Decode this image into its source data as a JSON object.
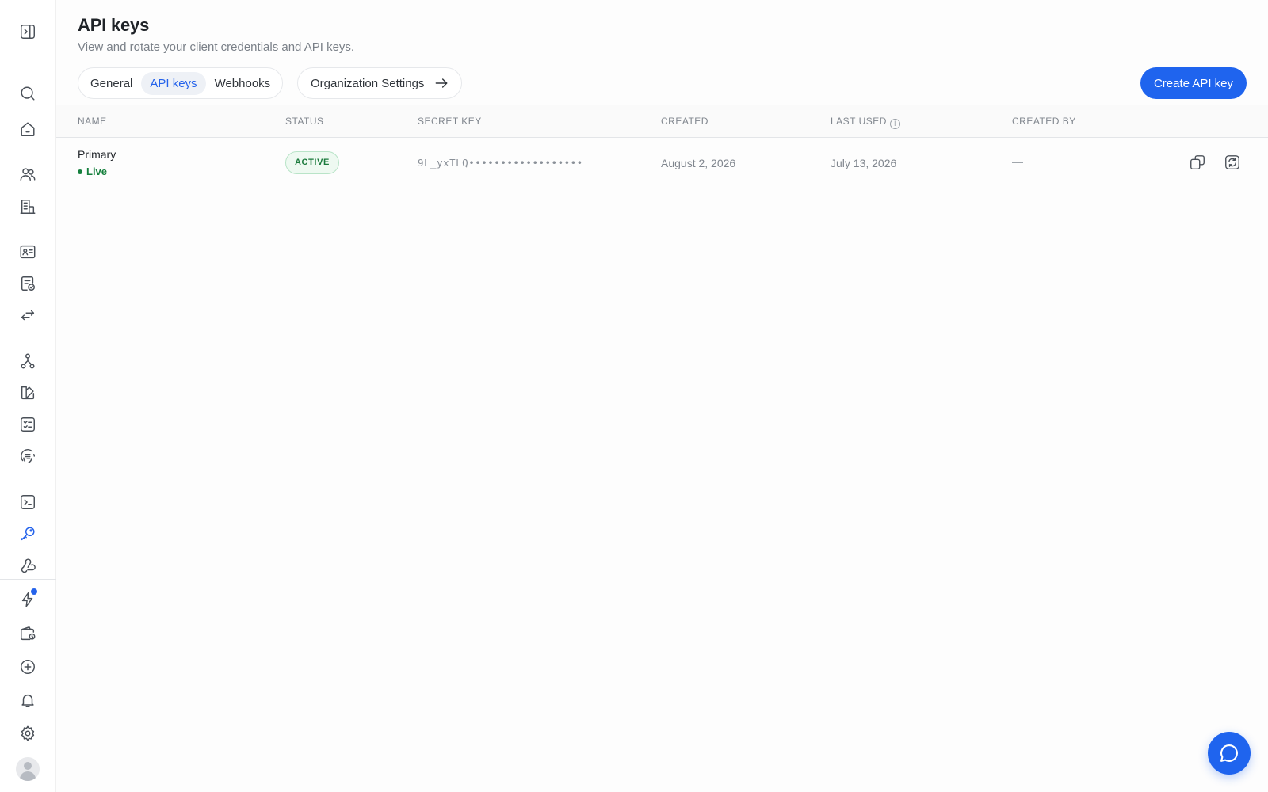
{
  "sidebar": {
    "icons": [
      "panel-toggle-icon",
      "search-icon",
      "home-icon",
      "users-icon",
      "building-icon",
      "contact-card-icon",
      "document-check-icon",
      "transfer-icon",
      "workflow-icon",
      "design-icon",
      "checklist-icon",
      "fingerprint-icon",
      "terminal-icon",
      "key-icon",
      "webhook-icon",
      "lightning-icon",
      "wallet-icon",
      "add-circle-icon",
      "bell-icon",
      "gear-icon",
      "avatar"
    ],
    "active_icon": "key-icon",
    "notification_on": "lightning-icon"
  },
  "header": {
    "title": "API keys",
    "subtitle": "View and rotate your client credentials and API keys."
  },
  "tabs": [
    {
      "label": "General",
      "active": false
    },
    {
      "label": "API keys",
      "active": true
    },
    {
      "label": "Webhooks",
      "active": false
    }
  ],
  "org_link": {
    "label": "Organization Settings"
  },
  "create_button": {
    "label": "Create API key"
  },
  "table": {
    "columns": [
      "Name",
      "Status",
      "Secret key",
      "Created",
      "Last used",
      "Created by"
    ],
    "rows": [
      {
        "name": "Primary",
        "environment": "Live",
        "status": "ACTIVE",
        "secret_key": "9L_yxTLQ••••••••••••••••••",
        "created": "August 2, 2026",
        "last_used": "July 13, 2026",
        "created_by": "—"
      }
    ]
  },
  "colors": {
    "accent": "#1f64ee",
    "active_tab_text": "#2563eb",
    "status_green": "#1b7a3c",
    "live_green": "#15803d"
  }
}
